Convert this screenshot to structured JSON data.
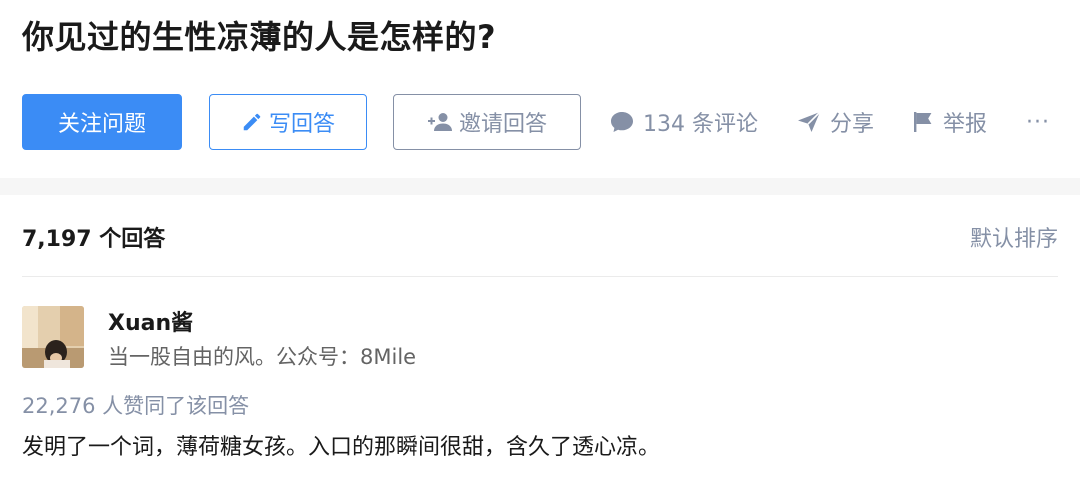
{
  "question": {
    "title": "你见过的生性凉薄的人是怎样的?"
  },
  "actions": {
    "follow_label": "关注问题",
    "write_label": "写回答",
    "invite_label": "邀请回答",
    "comments_label": "134 条评论",
    "share_label": "分享",
    "report_label": "举报",
    "more_label": "···"
  },
  "icons": {
    "write": "pencil-icon",
    "invite": "add-person-icon",
    "comments": "comment-bubble-icon",
    "share": "paper-plane-icon",
    "report": "flag-icon",
    "more": "more-dots-icon"
  },
  "colors": {
    "brand_blue": "#3b8cf5",
    "muted_gray": "#8590a6"
  },
  "answers": {
    "count_label": "7,197 个回答",
    "sort_label": "默认排序"
  },
  "answer": {
    "author_name": "Xuan酱",
    "author_bio": "当一股自由的风。公众号：8Mile",
    "vote_info": "22,276 人赞同了该回答",
    "excerpt": "发明了一个词，薄荷糖女孩。入口的那瞬间很甜，含久了透心凉。"
  }
}
